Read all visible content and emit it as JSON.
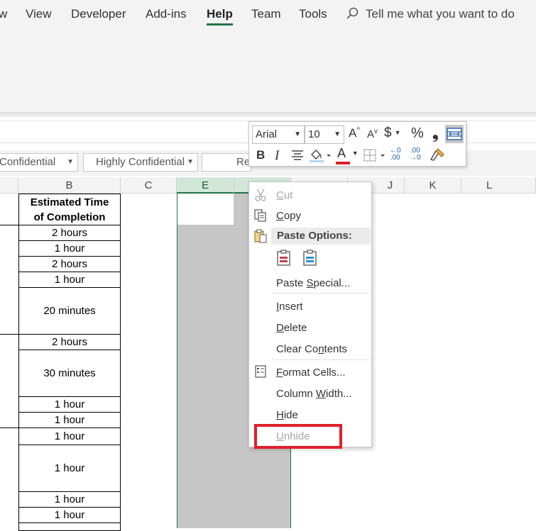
{
  "ribbon": {
    "tabs": [
      {
        "label": "w"
      },
      {
        "label": "View"
      },
      {
        "label": "Developer"
      },
      {
        "label": "Add-ins"
      },
      {
        "label": "Help"
      },
      {
        "label": "Team"
      },
      {
        "label": "Tools"
      }
    ],
    "active_tab": "Help",
    "tell_me": "Tell me what you want to do"
  },
  "sensitivity_labels": [
    "Confidential",
    "Highly Confidential",
    "Re"
  ],
  "columns": [
    "B",
    "C",
    "E",
    "J",
    "K",
    "L"
  ],
  "sheet": {
    "header_b": [
      "Estimated Time",
      "of Completion"
    ],
    "rows": [
      "2 hours",
      "1 hour",
      "2 hours",
      "1 hour",
      "20 minutes",
      "2 hours",
      "30 minutes",
      "1 hour",
      "1 hour",
      "1 hour",
      "1 hour",
      "1 hour",
      "1 hour"
    ]
  },
  "mini_toolbar": {
    "font": "Arial",
    "size": "10",
    "grow_font": "A",
    "shrink_font": "A",
    "currency": "$",
    "percent": "%",
    "comma": "❟",
    "bold": "B",
    "italic": "I",
    "font_color": "A",
    "inc_decimal": ".00",
    "dec_decimal": ".00"
  },
  "context_menu": {
    "cut": {
      "pre": "",
      "u": "C",
      "post": "ut"
    },
    "copy": {
      "pre": "",
      "u": "C",
      "post": "opy"
    },
    "paste_options": "Paste Options:",
    "paste_special": {
      "pre": "Paste ",
      "u": "S",
      "post": "pecial..."
    },
    "insert": {
      "pre": "",
      "u": "I",
      "post": "nsert"
    },
    "delete": {
      "pre": "",
      "u": "D",
      "post": "elete"
    },
    "clear_contents": {
      "pre": "Clear Co",
      "u": "n",
      "post": "tents"
    },
    "format_cells": {
      "pre": "",
      "u": "F",
      "post": "ormat Cells..."
    },
    "column_width": {
      "pre": "Column ",
      "u": "W",
      "post": "idth..."
    },
    "hide": {
      "pre": "",
      "u": "H",
      "post": "ide"
    },
    "unhide": {
      "pre": "",
      "u": "U",
      "post": "nhide"
    }
  },
  "colors": {
    "accent": "#217346",
    "highlight": "#e0202a",
    "selected_column": "#c6c6c6"
  }
}
